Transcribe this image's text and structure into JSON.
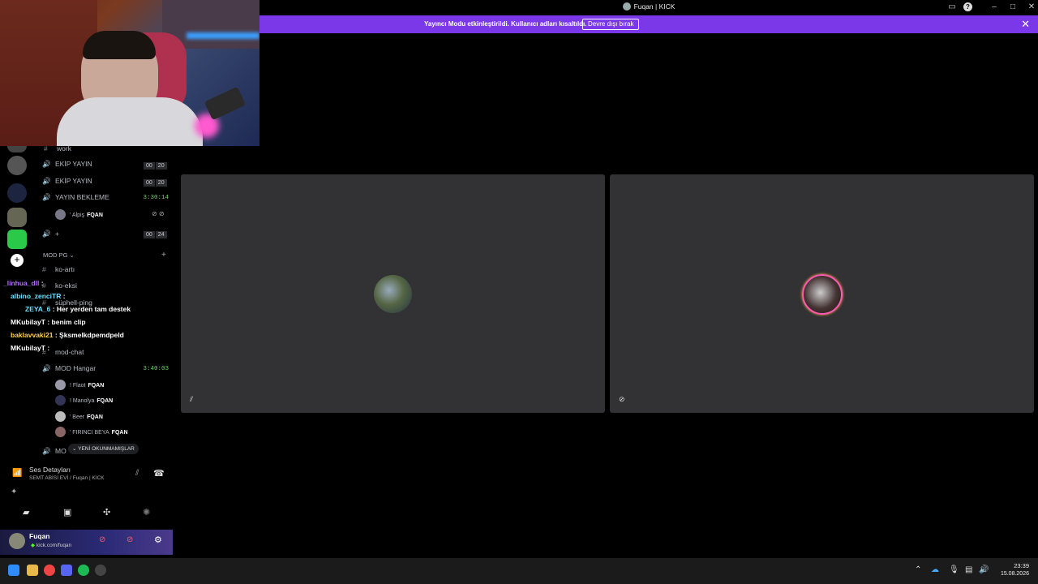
{
  "window": {
    "title": "Fuqan | KICK"
  },
  "banner": {
    "text": "Yayıncı Modu etkinleştirildi. Kullanıcı adları kısaltıldı.",
    "button_label": "Devre dışı bırak",
    "color": "#7a38e8"
  },
  "sidebar": {
    "channels": [
      {
        "name": "work",
        "type": "text"
      },
      {
        "name": "EKİP YAYIN",
        "type": "voice",
        "counts": [
          "00",
          "20"
        ]
      },
      {
        "name": "EKİP YAYIN",
        "type": "voice",
        "counts": [
          "00",
          "20"
        ]
      },
      {
        "name": "YAYIN BEKLEME",
        "type": "voice",
        "timer": "3:30:14"
      },
      {
        "name": "+",
        "type": "voice",
        "counts": [
          "00",
          "24"
        ]
      }
    ],
    "yayin_user": {
      "name": "' Alpiş",
      "tag": "FQAN"
    },
    "category": "MOD PG",
    "mod_channels": [
      "ko-artı",
      "ko-eksi",
      "süphell-ping",
      "mod-chat"
    ],
    "mod_hangar": {
      "name": "MOD Hangar",
      "timer": "3:40:03",
      "users": [
        {
          "name": "! Flaot",
          "tag": "FQAN"
        },
        {
          "name": "! Manolya",
          "tag": "FQAN"
        },
        {
          "name": "' Beer",
          "tag": "FQAN"
        },
        {
          "name": "' FIRINCI BEYA",
          "tag": "FQAN"
        }
      ]
    },
    "last_channel_partial": "MO",
    "unread_pill": "YENİ OKUNMAMIŞLAR"
  },
  "chat_overlay": [
    {
      "user": "_linhua_dll",
      "msg": ":",
      "color": "#b070ff"
    },
    {
      "user": "albino_zenciTR",
      "msg": ":",
      "color": "#6fe0ff"
    },
    {
      "user": "ZEYA_6",
      "msg": ": Her yerden tam destek",
      "color": "#6fe0ff"
    },
    {
      "user": "MKubilayT",
      "msg": ": benim clip",
      "color": "#ffffff"
    },
    {
      "user": "baklavvaki21",
      "msg": ": Şksmelkdpemdpeld",
      "color": "#ffd24a"
    },
    {
      "user": "MKubilayT",
      "msg": ":",
      "color": "#ffffff"
    }
  ],
  "voice_panel": {
    "title": "Ses Detayları",
    "subtitle": "SEMT ABİSİ EVİ / Fuqan | KICK"
  },
  "user_panel": {
    "name": "Fuqan",
    "status": "kick.com/fuqan"
  },
  "taskbar": {
    "time": "23:39",
    "date": "15.08.2026"
  }
}
